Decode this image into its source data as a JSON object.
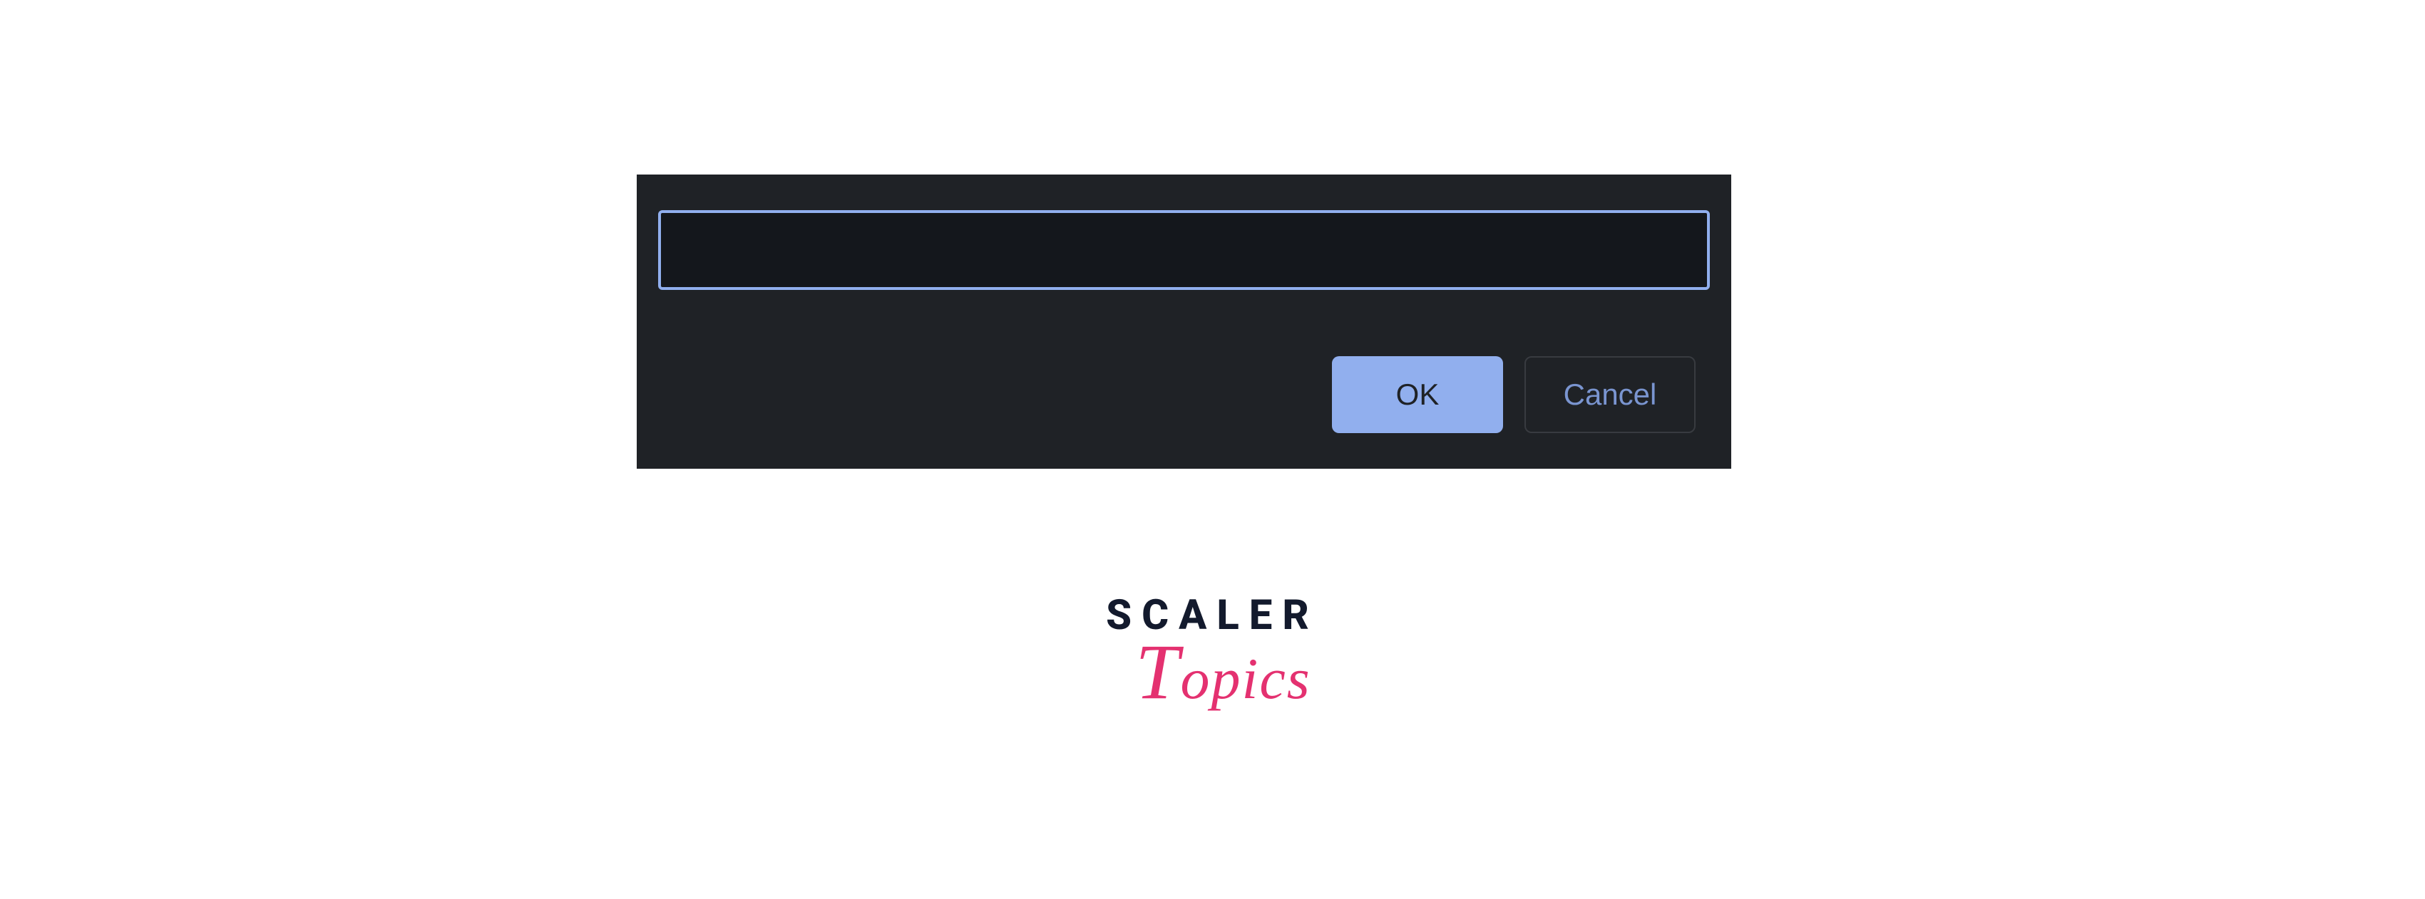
{
  "dialog": {
    "input": {
      "value": "",
      "placeholder": ""
    },
    "buttons": {
      "ok_label": "OK",
      "cancel_label": "Cancel"
    }
  },
  "logo": {
    "line1": "SCALER",
    "line2": "Topics"
  },
  "colors": {
    "dialog_bg": "#1f2226",
    "input_bg": "#14171c",
    "input_border": "#91afee",
    "ok_button_bg": "#91afee",
    "cancel_text": "#7a95d0",
    "logo_dark": "#131a2d",
    "logo_pink": "#e43170"
  }
}
